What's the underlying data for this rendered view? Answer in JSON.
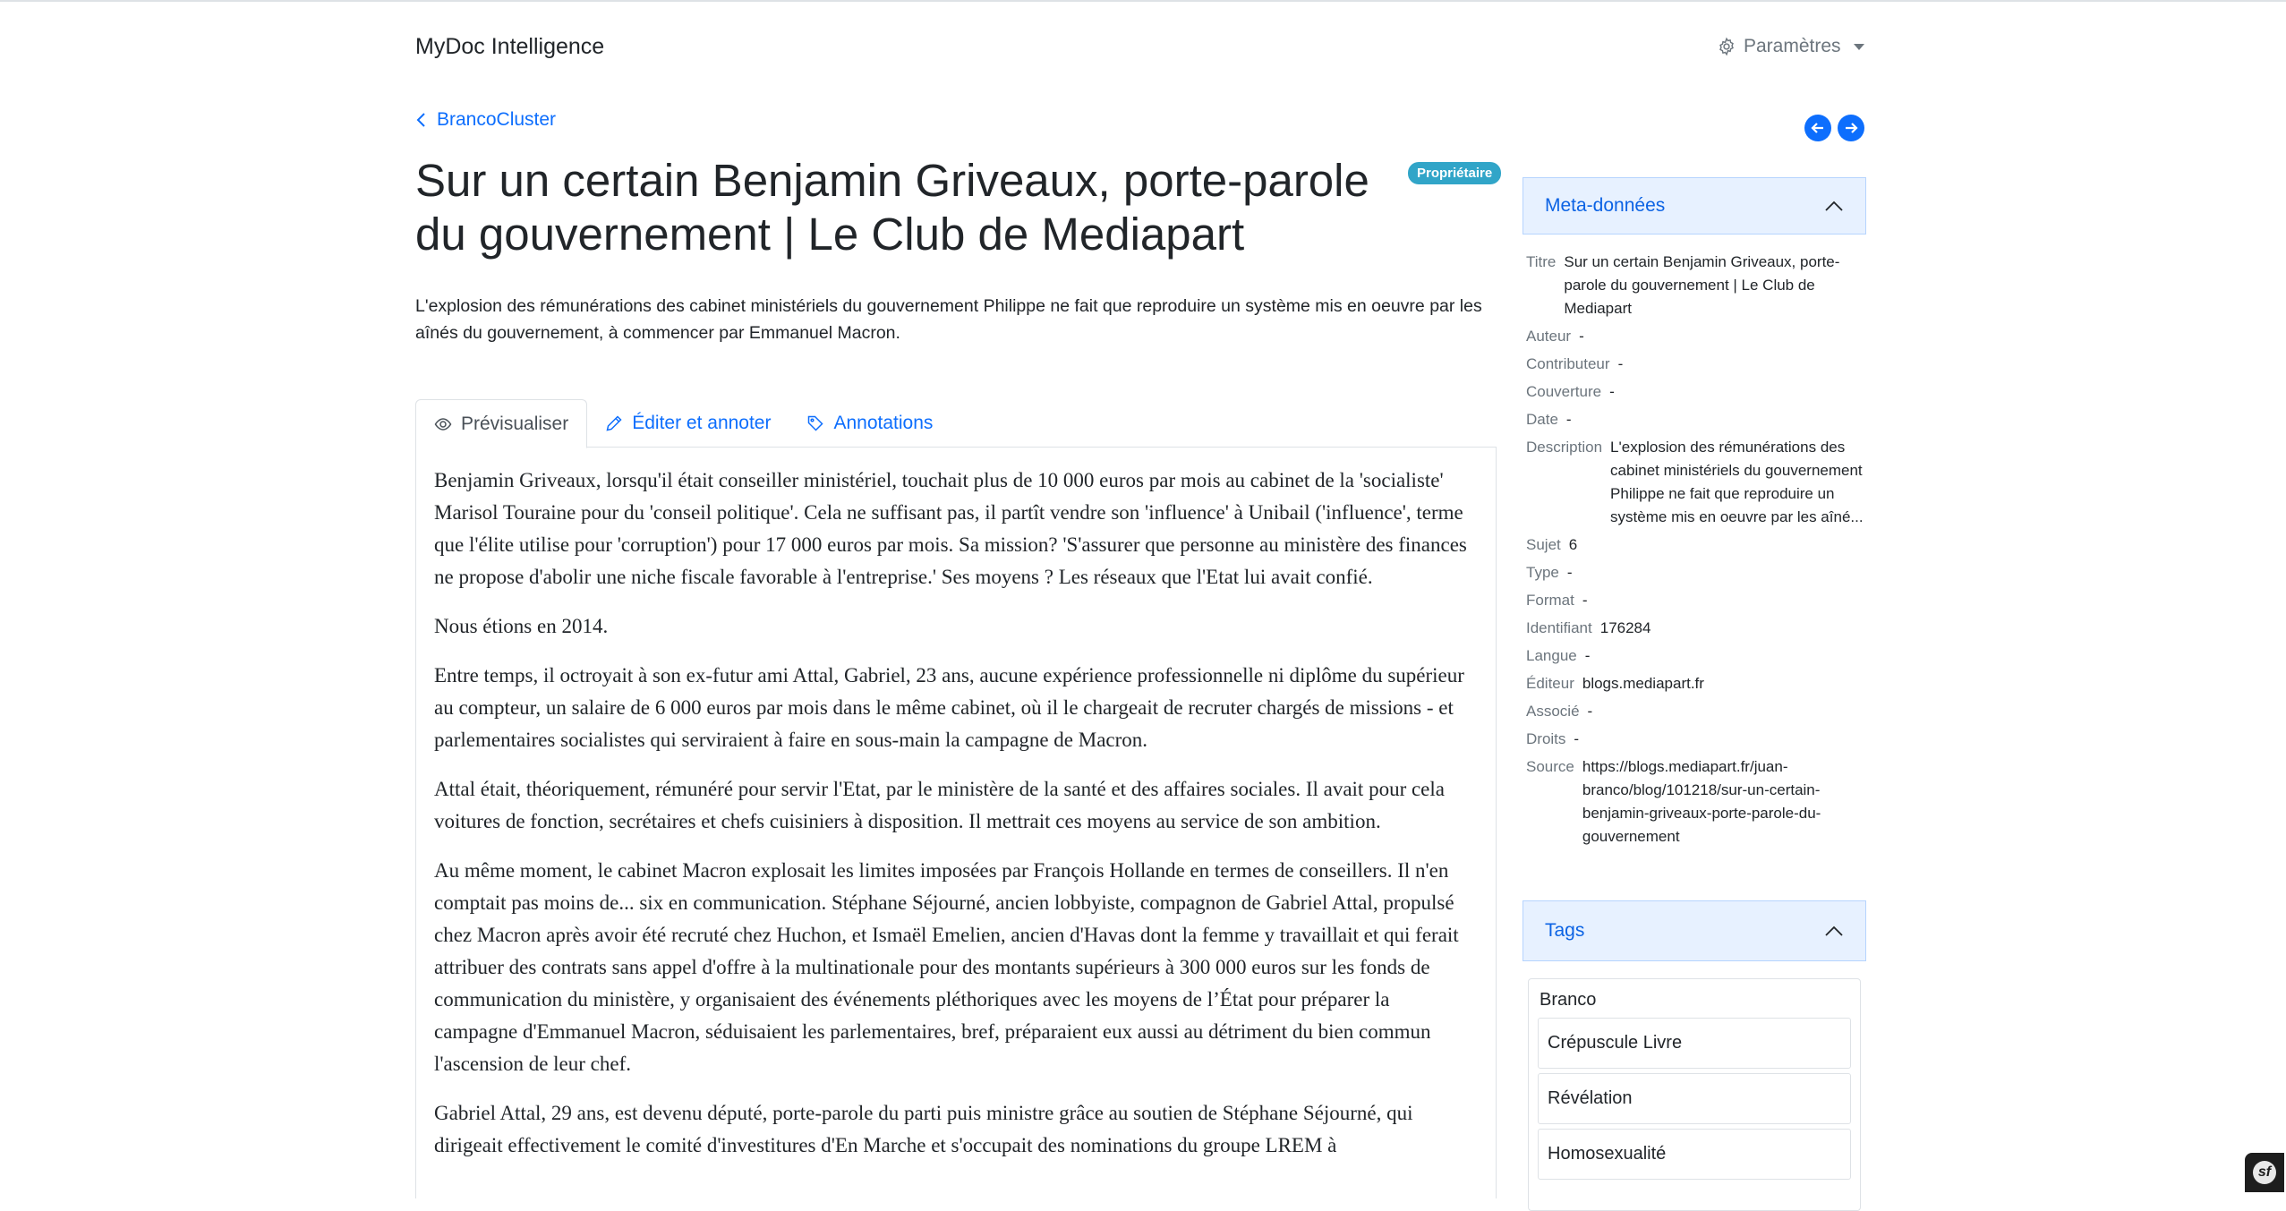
{
  "navbar": {
    "brand": "MyDoc Intelligence",
    "settings_label": "Paramètres"
  },
  "breadcrumb": {
    "back_label": "BrancoCluster"
  },
  "document": {
    "title": "Sur un certain Benjamin Griveaux, porte-parole du gouvernement | Le Club de Mediapart",
    "badge": "Propriétaire",
    "summary": "L'explosion des rémunérations des cabinet ministériels du gouvernement Philippe ne fait que reproduire un système mis en oeuvre par les aînés du gouvernement, à commencer par Emmanuel Macron."
  },
  "tabs": [
    {
      "label": "Prévisualiser",
      "icon": "eye-icon",
      "active": true
    },
    {
      "label": "Éditer et annoter",
      "icon": "pencil-icon",
      "active": false
    },
    {
      "label": "Annotations",
      "icon": "tag-icon",
      "active": false
    }
  ],
  "content": {
    "paragraphs": [
      "Benjamin Griveaux, lorsqu'il était conseiller ministériel, touchait plus de 10 000 euros par mois au cabinet de la 'socialiste' Marisol Touraine pour du 'conseil politique'. Cela ne suffisant pas, il partît vendre son 'influence' à Unibail ('influence', terme que l'élite utilise pour 'corruption') pour 17 000 euros par mois. Sa mission? 'S'assurer que personne au ministère des finances ne propose d'abolir une niche fiscale favorable à l'entreprise.' Ses moyens ? Les réseaux que l'Etat lui avait confié.",
      "Nous étions en 2014.",
      "Entre temps, il octroyait à son ex-futur ami Attal, Gabriel, 23 ans, aucune expérience professionnelle ni diplôme du supérieur au compteur, un salaire de 6 000 euros par mois dans le même cabinet, où il le chargeait de recruter chargés de missions - et parlementaires socialistes qui serviraient à faire en sous-main la campagne de Macron.",
      "Attal était, théoriquement, rémunéré pour servir l'Etat, par le ministère de la santé et des affaires sociales. Il avait pour cela voitures de fonction, secrétaires et chefs cuisiniers à disposition. Il mettrait ces moyens au service de son ambition.",
      "Au même moment, le cabinet Macron explosait les limites imposées par François Hollande en termes de conseillers. Il n'en comptait pas moins de... six en communication. Stéphane Séjourné, ancien lobbyiste, compagnon de Gabriel Attal, propulsé chez Macron après avoir été recruté chez Huchon, et Ismaël Emelien, ancien d'Havas dont la femme y travaillait et qui ferait attribuer des contrats sans appel d'offre à la multinationale pour des montants supérieurs à 300 000 euros sur les fonds de communication du ministère, y organisaient des événements pléthoriques avec les moyens de l’État pour préparer la campagne d'Emmanuel Macron, séduisaient les parlementaires, bref, préparaient eux aussi au détriment du bien commun l'ascension de leur chef.",
      "Gabriel Attal, 29 ans, est devenu député, porte-parole du parti puis ministre grâce au soutien de Stéphane Séjourné, qui dirigeait effectivement le comité d'investitures d'En Marche et s'occupait des nominations du groupe LREM à"
    ]
  },
  "sidebar": {
    "meta_title": "Meta-données",
    "meta": [
      {
        "key": "Titre",
        "value": "Sur un certain Benjamin Griveaux, porte-parole du gouvernement | Le Club de Mediapart"
      },
      {
        "key": "Auteur",
        "value": "-"
      },
      {
        "key": "Contributeur",
        "value": "-"
      },
      {
        "key": "Couverture",
        "value": "-"
      },
      {
        "key": "Date",
        "value": "-"
      },
      {
        "key": "Description",
        "value": "L'explosion des rémunérations des cabinet ministériels du gouvernement Philippe ne fait que reproduire un système mis en oeuvre par les aîné..."
      },
      {
        "key": "Sujet",
        "value": "6"
      },
      {
        "key": "Type",
        "value": "-"
      },
      {
        "key": "Format",
        "value": "-"
      },
      {
        "key": "Identifiant",
        "value": "176284"
      },
      {
        "key": "Langue",
        "value": "-"
      },
      {
        "key": "Éditeur",
        "value": "blogs.mediapart.fr"
      },
      {
        "key": "Associé",
        "value": "-"
      },
      {
        "key": "Droits",
        "value": "-"
      },
      {
        "key": "Source",
        "value": "https://blogs.mediapart.fr/juan-branco/blog/101218/sur-un-certain-benjamin-griveaux-porte-parole-du-gouvernement"
      }
    ],
    "tags_title": "Tags",
    "tag_group": "Branco",
    "tags": [
      "Crépuscule Livre",
      "Révélation",
      "Homosexualité"
    ]
  },
  "corner_badge": "sf"
}
